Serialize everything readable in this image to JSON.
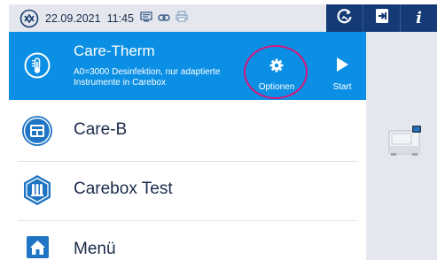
{
  "status_bar": {
    "date": "22.09.2021",
    "time": "11:45",
    "accent": "#143b76"
  },
  "selected_program": {
    "title": "Care-Therm",
    "description_line1": "A0=3000 Desinfektion, nur adaptierte",
    "description_line2": "Instrumente in Carebox",
    "options_label": "Optionen",
    "start_label": "Start",
    "color": "#0b8fe4",
    "highlight_color": "#d4187a"
  },
  "programs": [
    {
      "label": "Care-B",
      "icon": "carebox-icon"
    },
    {
      "label": "Carebox Test",
      "icon": "carebox-test-icon"
    }
  ],
  "menu": {
    "label": "Menü",
    "icon": "home-icon"
  },
  "icons": {
    "logo": "logo-badge-icon",
    "status": [
      "display-icon",
      "link-icon",
      "printer-icon"
    ],
    "toolbar": [
      "refresh-icon",
      "export-icon",
      "info-icon"
    ],
    "side_panel": "sterilizer-device-icon"
  }
}
